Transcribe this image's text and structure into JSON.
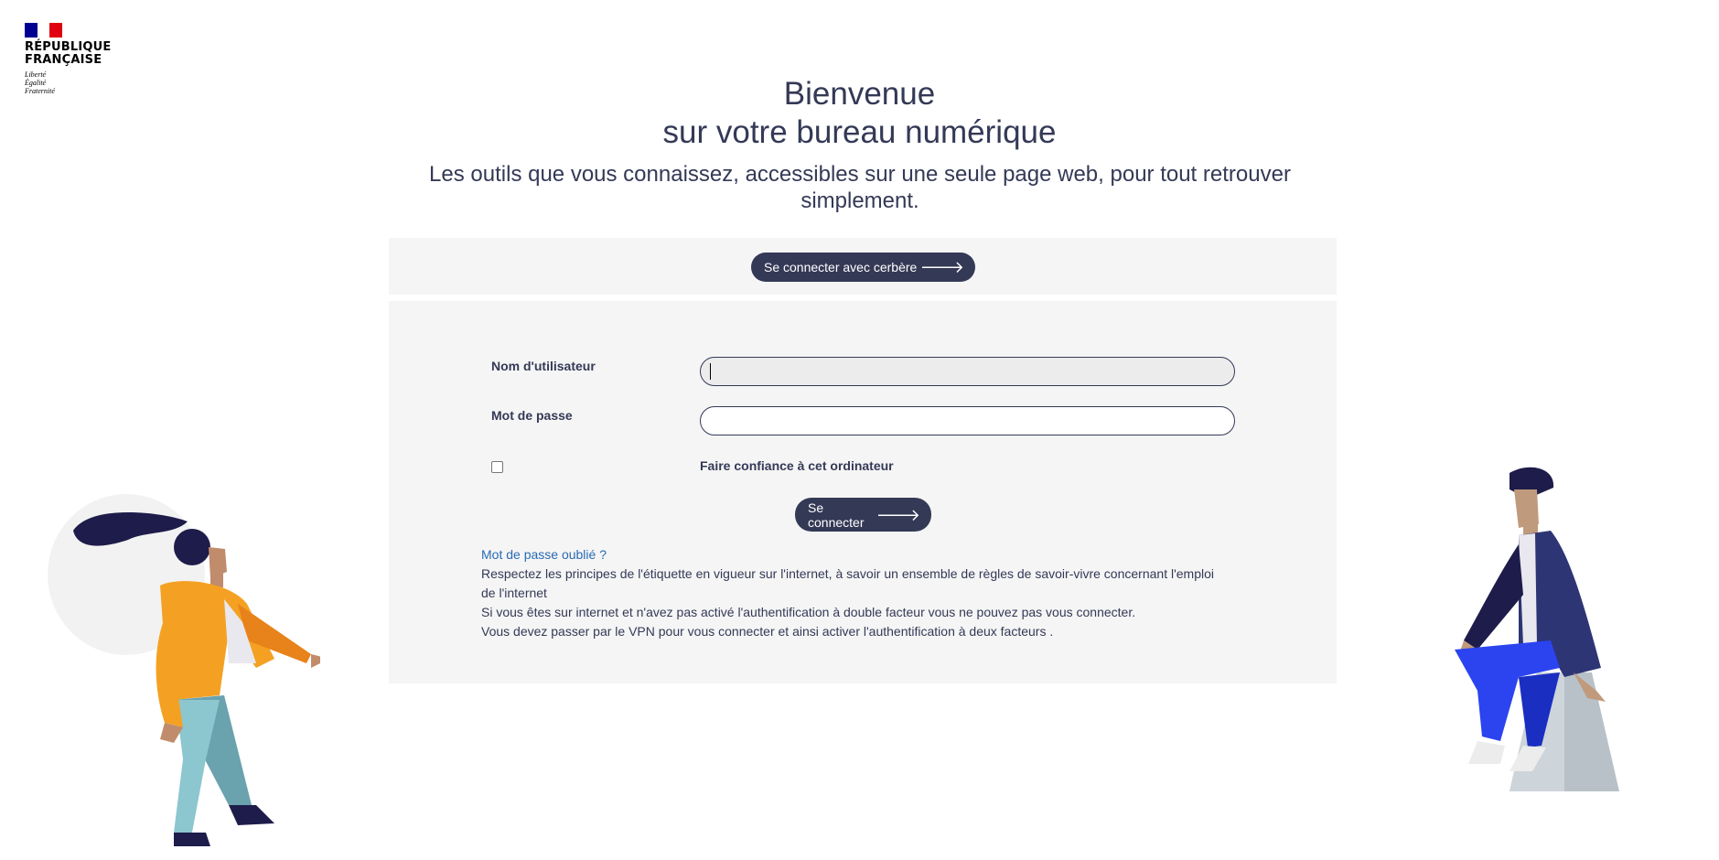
{
  "branding": {
    "logo_line1": "RÉPUBLIQUE",
    "logo_line2": "FRANÇAISE",
    "motto": [
      "Liberté",
      "Égalité",
      "Fraternité"
    ],
    "flag_colors": [
      "#000091",
      "#ffffff",
      "#e1000f"
    ]
  },
  "header": {
    "title_line1": "Bienvenue",
    "title_line2": "sur votre bureau numérique",
    "subtitle": "Les outils que vous connaissez, accessibles sur une seule page web, pour tout retrouver simplement."
  },
  "sso": {
    "button_label": "Se connecter avec cerbère"
  },
  "login_form": {
    "username_label": "Nom d'utilisateur",
    "username_value": "",
    "password_label": "Mot de passe",
    "password_value": "",
    "trust_label": "Faire confiance à cet ordinateur",
    "trust_checked": false,
    "submit_label": "Se connecter",
    "forgot_link": "Mot de passe oublié ?",
    "info_line1": "Respectez les principes de l'étiquette en vigueur sur l'internet, à savoir un ensemble de règles de savoir-vivre concernant l'emploi de l'internet",
    "info_line2": "Si vous êtes sur internet et n'avez pas activé l'authentification à double facteur vous ne pouvez pas vous connecter.",
    "info_line3": "Vous devez passer par le VPN pour vous connecter et ainsi activer l'authentification à deux facteurs ."
  },
  "colors": {
    "primary": "#343956",
    "panel_bg": "#f5f5f5",
    "link": "#2a6ab4"
  },
  "icons": {
    "arrow": "arrow-right-icon"
  }
}
